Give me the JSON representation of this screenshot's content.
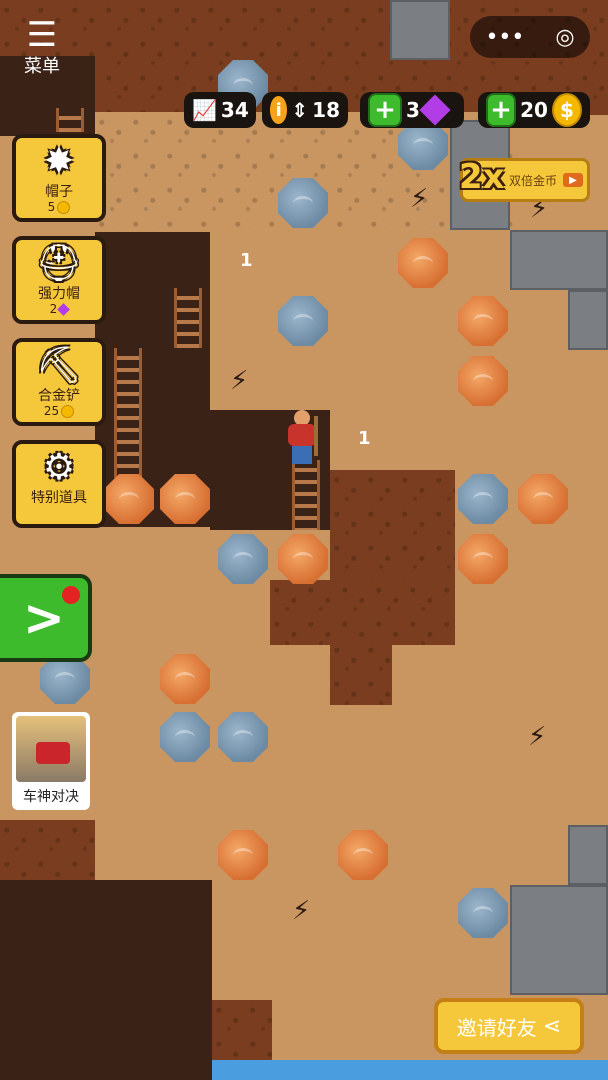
{
  "menu": {
    "label": "菜单",
    "icon": "menu-icon"
  },
  "capsule": {
    "more_icon": "•••",
    "close_icon": "◎"
  },
  "stats": {
    "depth": "34",
    "info_icon": "i",
    "moves": "18",
    "gems": "3",
    "coins": "20"
  },
  "double_coins": {
    "badge": "2x",
    "label": "双倍金币",
    "play_icon": "▶"
  },
  "tools": [
    {
      "name": "帽子",
      "cost": "5",
      "currency": "coin"
    },
    {
      "name": "强力帽",
      "cost": "2",
      "currency": "gem"
    },
    {
      "name": "合金铲",
      "cost": "25",
      "currency": "coin"
    },
    {
      "name": "特别道具",
      "cost": "",
      "currency": ""
    }
  ],
  "next_button": {
    "icon": ">"
  },
  "ad": {
    "label": "车神对决"
  },
  "invite": {
    "label": "邀请好友",
    "icon": "share-icon"
  },
  "floaters": [
    "1",
    "1"
  ],
  "colors": {
    "accent": "#f5c83c",
    "green": "#3dbb2d",
    "soil": "#c99662",
    "tunnel": "#3b2217"
  }
}
